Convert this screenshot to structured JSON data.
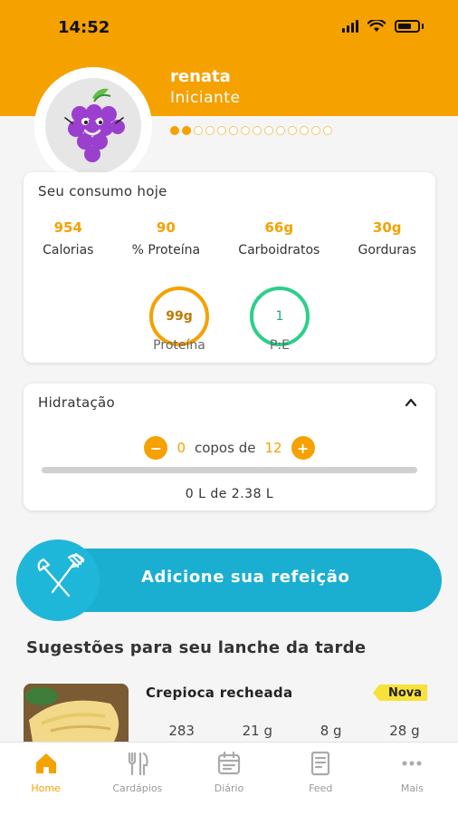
{
  "status_bar": {
    "time": "14:52"
  },
  "profile": {
    "name": "renata",
    "level": "Iniciante",
    "progress_dots_total": 14,
    "progress_dots_filled": 2
  },
  "consumo": {
    "title": "Seu consumo hoje",
    "macros": [
      {
        "value": "954",
        "label": "Calorias"
      },
      {
        "value": "90",
        "label": "% Proteína"
      },
      {
        "value": "66g",
        "label": "Carboidratos"
      },
      {
        "value": "30g",
        "label": "Gorduras"
      }
    ],
    "proteina": {
      "value": "99g",
      "label": "Proteína"
    },
    "pe": {
      "value": "1",
      "label": "P:E"
    }
  },
  "hidratacao": {
    "title": "Hidratação",
    "minus": "−",
    "plus": "+",
    "cups_value": "0",
    "cups_text": "copos de",
    "cups_goal": "12",
    "progress_fraction": 0,
    "liters_text": "0 L  de  2.38 L"
  },
  "add_meal": {
    "label": "Adicione sua refeição"
  },
  "suggestions": {
    "title": "Sugestões para seu lanche da tarde",
    "items": [
      {
        "name": "Crepioca recheada",
        "badge": "Nova",
        "stats": [
          "283",
          "21 g",
          "8 g",
          "28 g"
        ]
      }
    ]
  },
  "tabs": [
    {
      "label": "Home",
      "icon": "home-icon",
      "active": true
    },
    {
      "label": "Cardápios",
      "icon": "cutlery-icon",
      "active": false
    },
    {
      "label": "Diário",
      "icon": "calendar-icon",
      "active": false
    },
    {
      "label": "Feed",
      "icon": "document-icon",
      "active": false
    },
    {
      "label": "Mais",
      "icon": "more-icon",
      "active": false
    }
  ],
  "colors": {
    "brand_orange": "#f5a100",
    "brand_blue": "#1aaed1",
    "green": "#2ccf8a",
    "badge_yellow": "#f8e23a"
  }
}
